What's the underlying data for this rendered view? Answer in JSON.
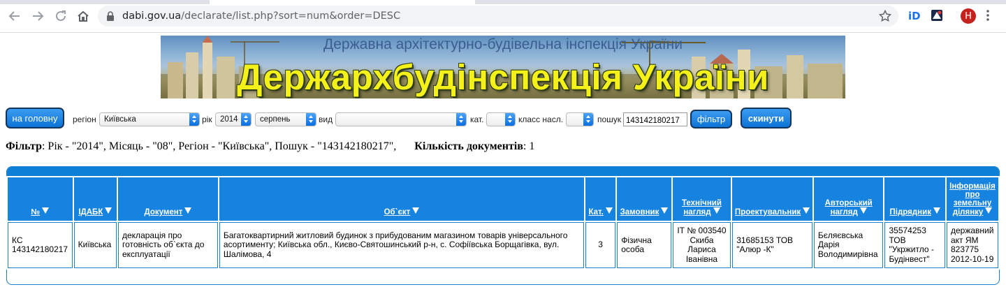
{
  "browser": {
    "url_host": "dabi.gov.ua",
    "url_path": "/declarate/list.php?sort=num&order=DESC",
    "profile_initial": "H"
  },
  "banner": {
    "subtitle": "Державна архітектурно-будівельна інспекція України",
    "title": "Держархбудінспекція України"
  },
  "filters": {
    "home_button": "на головну",
    "region_label": "регіон",
    "region_value": "Київська",
    "year_label": "рік",
    "year_value": "2014",
    "month_value": "серпень",
    "type_label": "вид",
    "type_value": "",
    "category_label": "кат.",
    "category_value": "",
    "class_label": "класс насл.",
    "class_value": "",
    "search_label": "пошук",
    "search_value": "143142180217",
    "filter_button": "фільтр",
    "reset_button": "скинути"
  },
  "summary": {
    "filter_label": "Фільтр",
    "filter_text": ": Рік - \"2014\", Місяць - \"08\", Регіон - \"Київська\", Пошук - \"143142180217\",",
    "count_label": "Кількість документів",
    "count_text": ": 1"
  },
  "table": {
    "headers": [
      "№",
      "ІДАБК",
      "Документ",
      "Об`єкт",
      "Кат.",
      "Замовник",
      "Технічний нагляд",
      "Проектувальник",
      "Авторський нагляд",
      "Підрядник",
      "Інформація про земельну ділянку"
    ],
    "rows": [
      [
        "КС 143142180217",
        "Київська",
        "декларація про готовність об`єкта до експлуатації",
        "Багатоквартирний житловий будинок з прибудованим магазином товарів універсального асортименту; Київська обл., Києво-Святошинський р-н, с. Софіївська Борщагівка, вул. Шалімова, 4",
        "3",
        "Фізична особа",
        "ІТ № 003540 Скиба Лариса Іванівна",
        "31685153 ТОВ \"Алюр -К\"",
        "Бєляєвська Дарія Володимирівна",
        "35574253 ТОВ \"Укржитло - Будінвест\"",
        "державний акт ЯМ 823775 2012-10-19"
      ]
    ]
  },
  "colors": {
    "accent": "#1683e1",
    "banner_title": "#f3f01a"
  }
}
